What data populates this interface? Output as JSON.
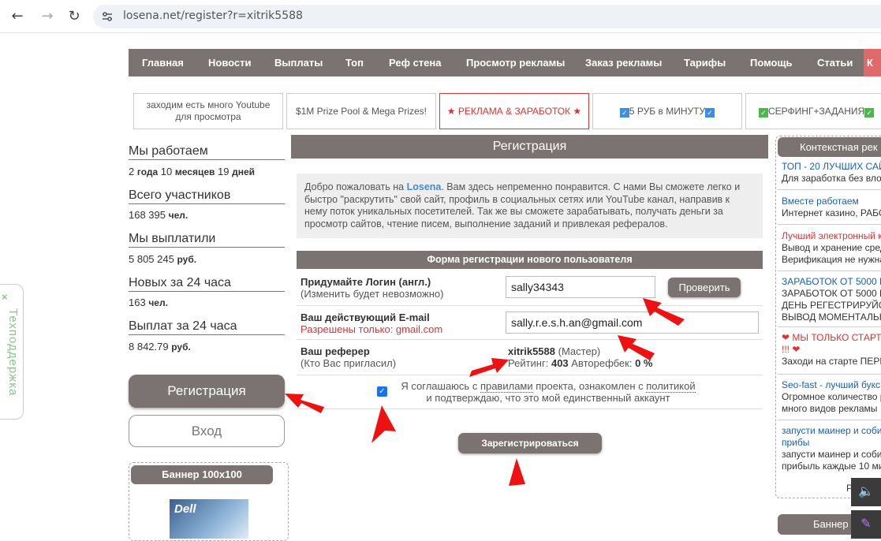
{
  "browser": {
    "url": "losena.net/register?r=xitrik5588"
  },
  "nav": {
    "items": [
      "Главная",
      "Новости",
      "Выплаты",
      "Топ",
      "Реф стена",
      "Просмотр рекламы",
      "Заказ рекламы",
      "Тарифы",
      "Помощь",
      "Статьи"
    ],
    "last_partial": "К"
  },
  "banners": [
    {
      "line1": "заходим есть много Youtube",
      "line2": "для просмотра"
    },
    {
      "line1": "$1M Prize Pool & Mega Prizes!",
      "line2": ""
    },
    {
      "line1": "★ РЕКЛАМА & ЗАРАБОТОК ★",
      "line2": ""
    },
    {
      "line1": "5 РУБ в МИНУТУ",
      "line2": ""
    },
    {
      "line1": "СЕРФИНГ+ЗАДАНИЯ",
      "line2": ""
    }
  ],
  "stats": {
    "working_label": "Мы работаем",
    "working_years": "2",
    "years_unit": "года",
    "working_months": "10",
    "months_unit": "месяцев",
    "working_days": "19",
    "days_unit": "дней",
    "members_label": "Всего участников",
    "members_value": "168 395",
    "members_unit": "чел.",
    "paid_label": "Мы выплатили",
    "paid_value": "5 805 245",
    "paid_unit": "руб.",
    "new24_label": "Новых за 24 часа",
    "new24_value": "163",
    "new24_unit": "чел.",
    "payout24_label": "Выплат за 24 часа",
    "payout24_value": "8 842.79",
    "payout24_unit": "руб."
  },
  "sidebar": {
    "register_label": "Регистрация",
    "login_label": "Вход",
    "banner_title": "Баннер 100x100",
    "banner_img_text": "Dell"
  },
  "support": {
    "close": "×",
    "label": "Техподдержка"
  },
  "registration": {
    "title": "Регистрация",
    "welcome_pre": "Добро пожаловать на ",
    "welcome_logo": "Losena",
    "welcome_post": ". Вам здесь непременно понравится. С нами Вы сможете легко и быстро \"раскрутить\" свой сайт, профиль в социальных сетях или YouTube канал, направив к нему поток уникальных посетителей. Так же вы сможете зарабатывать, получать деньги за просмотр сайтов, чтение писем, выполнение заданий и привлекая рефералов.",
    "form_title": "Форма регистрации нового пользователя",
    "login_label": "Придумайте Логин (англ.)",
    "login_sub": "(Изменить будет невозможно)",
    "login_value": "sally34343",
    "check_button": "Проверить",
    "email_label": "Ваш действующий E-mail",
    "email_sub": "Разрешены только: gmail.com",
    "email_value": "sally.r.e.s.h.an@gmail.com",
    "referrer_label": "Ваш реферер",
    "referrer_sub": "(Кто Вас пригласил)",
    "referrer_name": "xitrik5588",
    "referrer_status": "(Мастер)",
    "rating_label": "Рейтинг:",
    "rating_value": "403",
    "autoref_label": "Авторефбек:",
    "autoref_value": "0 %",
    "agree_pre": "Я соглашаюсь с ",
    "agree_rules": "правилами",
    "agree_mid": " проекта, ознакомлен с ",
    "agree_policy": "политикой",
    "agree_line2": "и подтверждаю, что это мой единственный аккаунт",
    "agree_checked": true,
    "submit_label": "Зарегистрироваться"
  },
  "context_ads": {
    "title": "Контекстная рек",
    "items": [
      {
        "title": "ТОП - 20 ЛУЧШИХ САЙ",
        "desc": [
          "Для заработка без вло"
        ],
        "red": false
      },
      {
        "title": "Вместе работаем",
        "desc": [
          "Интернет казино, РАБО"
        ],
        "red": false
      },
      {
        "title": "Лучший электронный к",
        "desc": [
          "Вывод и хранение сред",
          "Верификация не нужна"
        ],
        "red": true
      },
      {
        "title": "ЗАРАБОТОК ОТ 5000 Р",
        "desc": [
          "ЗАРАБОТОК ОТ 5000 Р",
          "ДЕНЬ РЕГЕСТРИРУЙС",
          "ВЫВОД МОМЕНТАЛЬН"
        ],
        "red": false
      },
      {
        "title": "МЫ ТОЛЬКО СТАРТ",
        "title2": "!!!",
        "desc": [
          "Заходи на старте ПЕРВ"
        ],
        "red": true,
        "hearts": true
      },
      {
        "title": "Seo-fast - лучший букс",
        "desc": [
          "Огромное количество р",
          "много видов рекламы"
        ],
        "red": false
      },
      {
        "title": "запусти маинер и соби",
        "title2": "прибы",
        "desc": [
          "запусти маинер и соби",
          "прибыль каждые 10 ми"
        ],
        "red": false
      }
    ],
    "partial_letter": "Р"
  },
  "banner_right": {
    "title": "Баннер"
  },
  "colors": {
    "nav_bg": "#7a7372",
    "accent_red": "#dd3333",
    "link_blue": "#1a5fb4",
    "annotation_arrow": "#ee1111"
  }
}
